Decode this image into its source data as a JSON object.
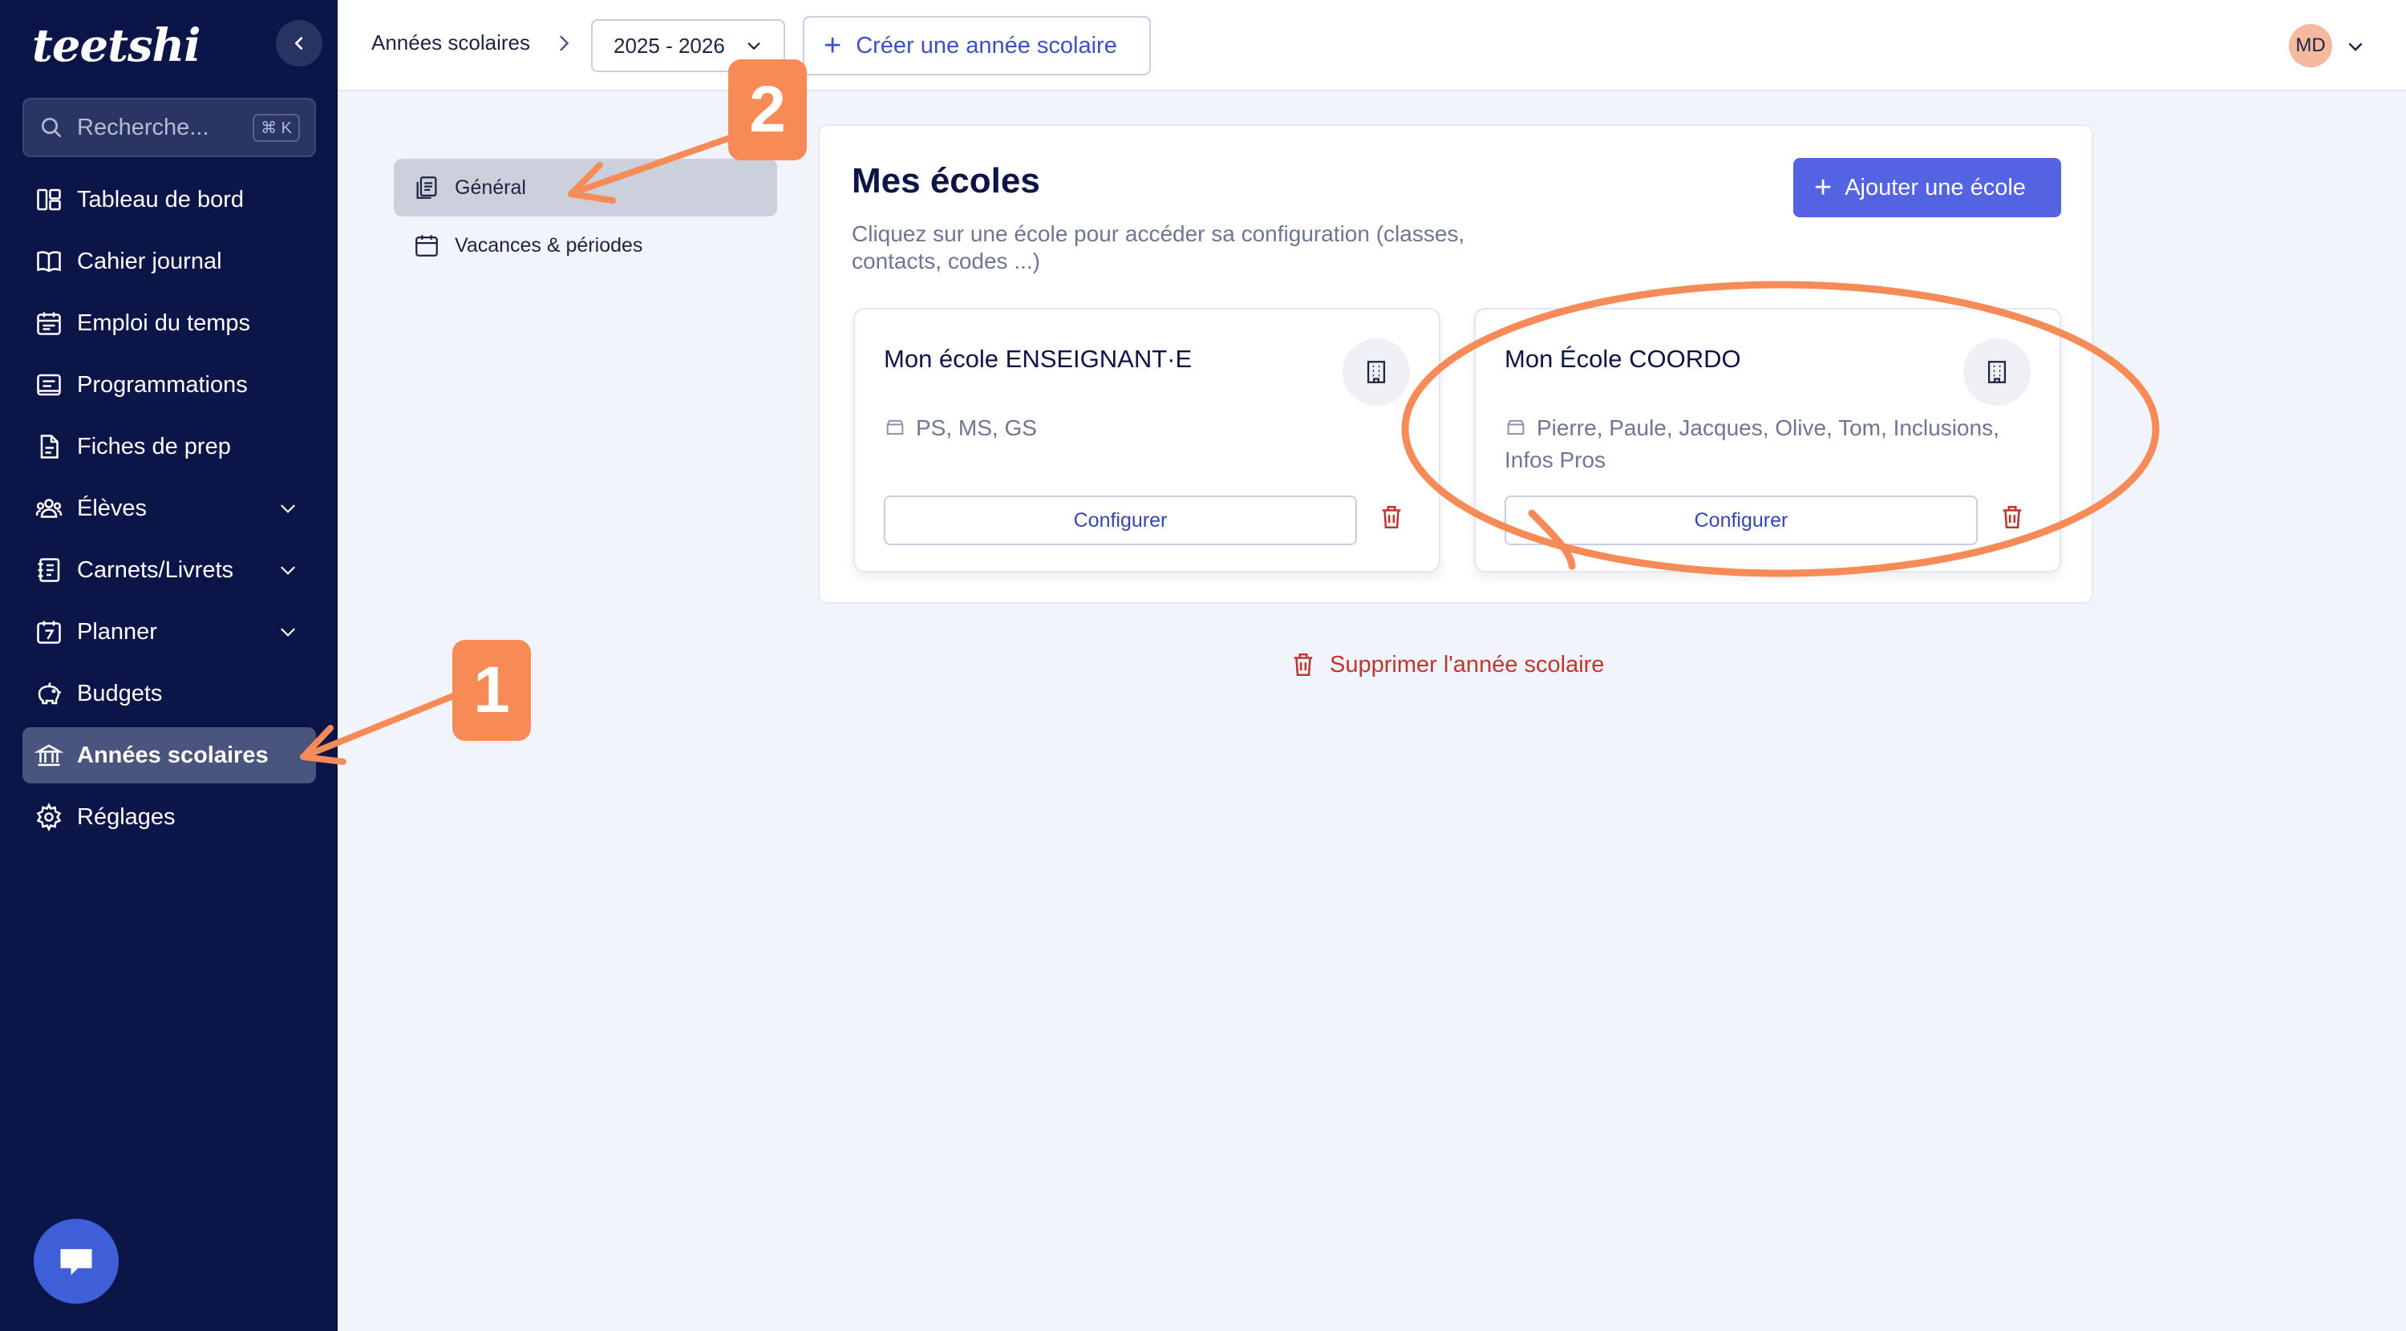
{
  "sidebar": {
    "logo": "teetshi",
    "search": {
      "placeholder": "Recherche...",
      "shortcut": "⌘ K"
    },
    "items": [
      {
        "label": "Tableau de bord",
        "icon": "dashboard-icon"
      },
      {
        "label": "Cahier journal",
        "icon": "book-icon"
      },
      {
        "label": "Emploi du temps",
        "icon": "calendar-icon"
      },
      {
        "label": "Programmations",
        "icon": "list-icon"
      },
      {
        "label": "Fiches de prep",
        "icon": "file-icon"
      },
      {
        "label": "Élèves",
        "icon": "users-icon",
        "expandable": true
      },
      {
        "label": "Carnets/Livrets",
        "icon": "notebook-icon",
        "expandable": true
      },
      {
        "label": "Planner",
        "icon": "planner-icon",
        "expandable": true
      },
      {
        "label": "Budgets",
        "icon": "piggy-bank-icon"
      },
      {
        "label": "Années scolaires",
        "icon": "bank-icon",
        "active": true
      },
      {
        "label": "Réglages",
        "icon": "gear-icon"
      }
    ]
  },
  "topbar": {
    "breadcrumb": "Années scolaires",
    "year_select": "2025 - 2026",
    "create_year_label": "Créer une année scolaire",
    "avatar_initials": "MD"
  },
  "subnav": {
    "items": [
      {
        "label": "Général",
        "active": true
      },
      {
        "label": "Vacances & périodes"
      }
    ]
  },
  "schools": {
    "title": "Mes écoles",
    "subtitle": "Cliquez sur une école pour accéder sa configuration (classes, contacts, codes ...)",
    "add_label": "Ajouter une école",
    "list": [
      {
        "name": "Mon école ENSEIGNANT·E",
        "classes": "PS, MS, GS",
        "configure_label": "Configurer"
      },
      {
        "name": "Mon École COORDO",
        "classes": "Pierre, Paule, Jacques, Olive, Tom, Inclusions, Infos Pros",
        "configure_label": "Configurer"
      }
    ]
  },
  "delete_year_label": "Supprimer l'année scolaire",
  "annotations": {
    "badge_1": "1",
    "badge_2": "2",
    "color": "#f68b57"
  },
  "colors": {
    "sidebar_bg": "#0b1547",
    "accent": "#5363e2",
    "danger": "#c1352f",
    "annotation": "#f68b57"
  }
}
